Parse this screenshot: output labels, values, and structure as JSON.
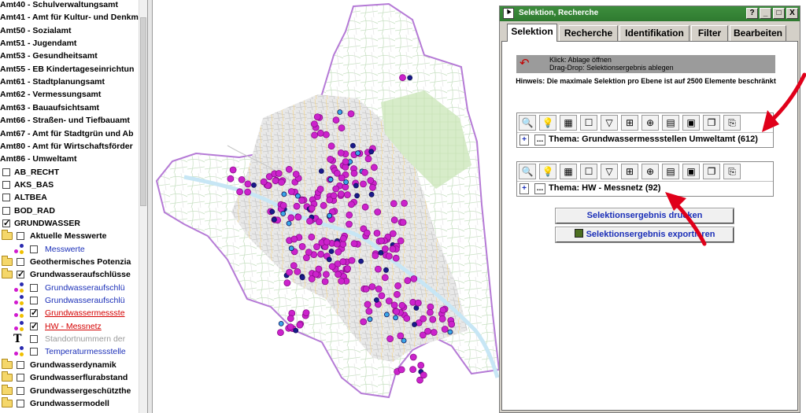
{
  "layer_tree": {
    "items": [
      {
        "label": "Amt40 - Schulverwaltungsamt"
      },
      {
        "label": "Amt41 - Amt für Kultur- und Denkm"
      },
      {
        "label": "Amt50 - Sozialamt"
      },
      {
        "label": "Amt51 - Jugendamt"
      },
      {
        "label": "Amt53 - Gesundheitsamt"
      },
      {
        "label": "Amt55 - EB Kindertageseinrichtun"
      },
      {
        "label": "Amt61 - Stadtplanungsamt"
      },
      {
        "label": "Amt62 - Vermessungsamt"
      },
      {
        "label": "Amt63 - Bauaufsichtsamt"
      },
      {
        "label": "Amt66 - Straßen- und Tiefbauamt"
      },
      {
        "label": "Amt67 - Amt für Stadtgrün und Ab"
      },
      {
        "label": "Amt80 - Amt für Wirtschaftsförder"
      },
      {
        "label": "Amt86 - Umweltamt"
      },
      {
        "label": "AB_RECHT",
        "checked": false
      },
      {
        "label": "AKS_BAS",
        "checked": false
      },
      {
        "label": "ALTBEA",
        "checked": false
      },
      {
        "label": "BOD_RAD",
        "checked": false
      },
      {
        "label": "GRUNDWASSER",
        "checked": true
      },
      {
        "label": "Aktuelle Messwerte",
        "checked": false
      },
      {
        "label": "Messwerte",
        "checked": false
      },
      {
        "label": "Geothermisches Potenzia",
        "checked": false
      },
      {
        "label": "Grundwasseraufschlüsse",
        "checked": true
      },
      {
        "label": "Grundwasseraufschlü",
        "checked": false
      },
      {
        "label": "Grundwasseraufschlü",
        "checked": false
      },
      {
        "label": "Grundwassermessste",
        "checked": true
      },
      {
        "label": "HW - Messnetz",
        "checked": true
      },
      {
        "label": "Standortnummern der",
        "checked": false
      },
      {
        "label": "Temperaturmessstelle",
        "checked": false
      },
      {
        "label": "Grundwasserdynamik",
        "checked": false
      },
      {
        "label": "Grundwasserflurabstand",
        "checked": false
      },
      {
        "label": "Grundwassergeschützthe",
        "checked": false
      },
      {
        "label": "Grundwassermodell",
        "checked": false
      }
    ]
  },
  "window": {
    "title": "Selektion, Recherche",
    "buttons": [
      "?",
      "_",
      "□",
      "X"
    ],
    "tabs": [
      {
        "label": "Selektion",
        "active": true
      },
      {
        "label": "Recherche",
        "active": false
      },
      {
        "label": "Identifikation",
        "active": false
      },
      {
        "label": "Filter",
        "active": false
      },
      {
        "label": "Bearbeiten",
        "active": false
      }
    ],
    "ablage": {
      "line1": "Klick: Ablage öffnen",
      "line2": "Drag-Drop: Selektionsergebnis ablegen"
    },
    "hinweis": "Hinweis: Die maximale Selektion pro Ebene ist auf 2500 Elemente beschränkt",
    "themes": [
      {
        "plus": "+",
        "dots": "...",
        "label": "Thema: Grundwassermessstellen Umweltamt (612)"
      },
      {
        "plus": "+",
        "dots": "...",
        "label": "Thema: HW - Messnetz (92)"
      }
    ],
    "print_button": "Selektionsergebnis drucken",
    "export_button": "Selektionsergebnis exportieren"
  },
  "colors": {
    "titlebar": "#2f7a30",
    "marker_magenta": "#cc22cc",
    "marker_navy": "#1a1a8c",
    "marker_cyan": "#3aa6e8",
    "annotation_red": "#e0001a",
    "link_blue": "#1b2fb8"
  }
}
